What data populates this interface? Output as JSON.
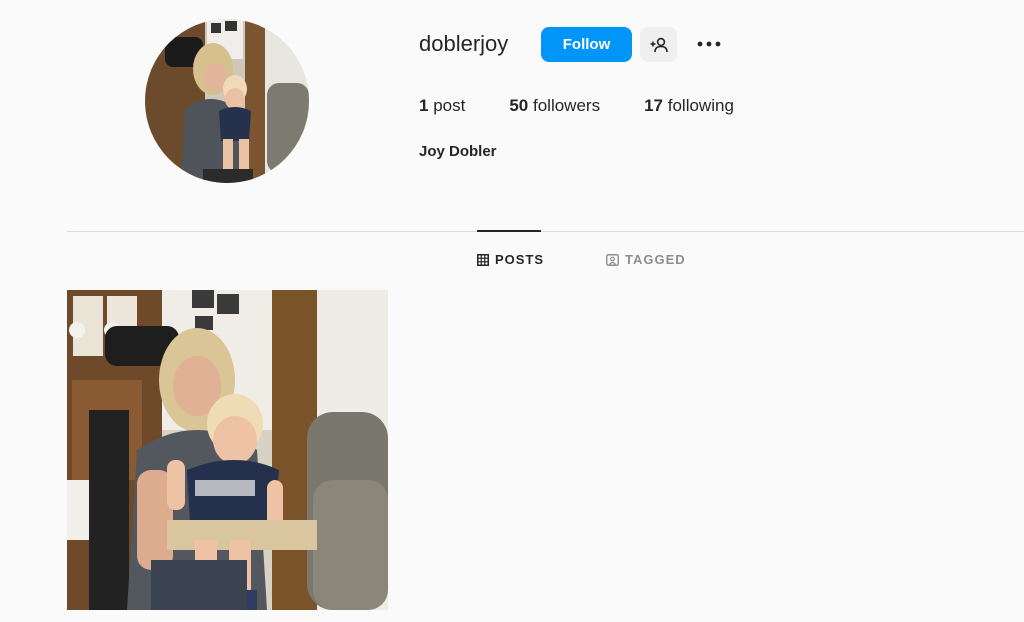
{
  "profile": {
    "username": "doblerjoy",
    "full_name": "Joy Dobler",
    "follow_label": "Follow",
    "suggest_icon": "person-add-icon",
    "more_icon": "more-options-icon"
  },
  "stats": {
    "posts_count": "1",
    "posts_label": "post",
    "followers_count": "50",
    "followers_label": "followers",
    "following_count": "17",
    "following_label": "following"
  },
  "tabs": [
    {
      "label": "POSTS",
      "icon": "grid-icon",
      "active": true
    },
    {
      "label": "TAGGED",
      "icon": "tagged-icon",
      "active": false
    }
  ],
  "posts": [
    {
      "description": "photo"
    }
  ],
  "colors": {
    "accent": "#0095f6",
    "text": "#262626",
    "muted": "#8e8e8e",
    "background": "#fafafa",
    "divider": "#dbdbdb"
  }
}
